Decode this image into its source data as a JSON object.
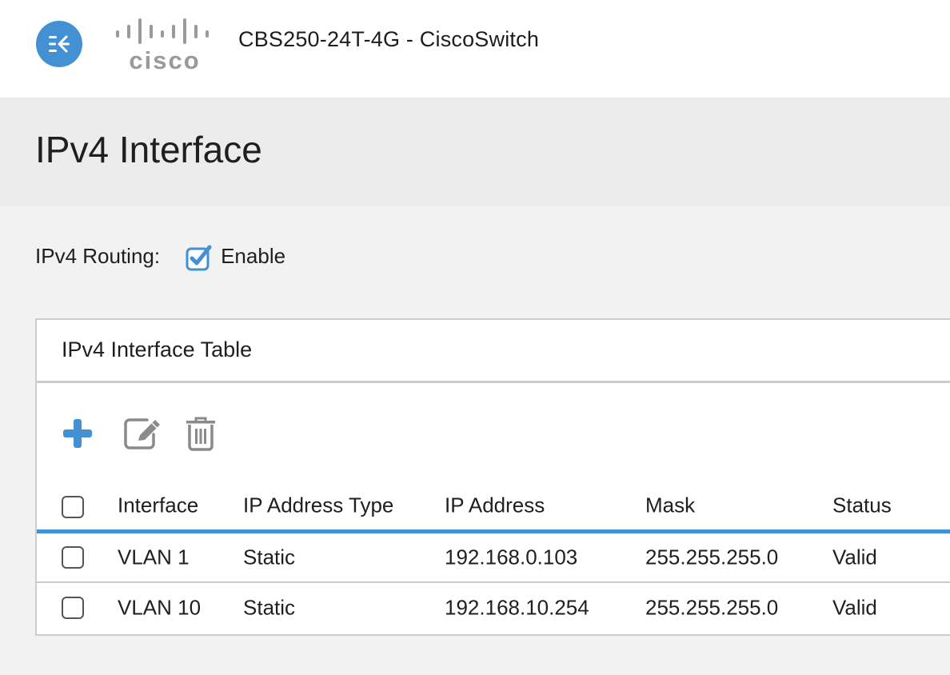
{
  "header": {
    "nav_toggle_icon": "collapse-menu-icon",
    "logo_text": "cisco",
    "app_title": "CBS250-24T-4G - CiscoSwitch"
  },
  "page": {
    "title": "IPv4 Interface"
  },
  "routing": {
    "label": "IPv4 Routing:",
    "checkbox_label": "Enable",
    "checked": true
  },
  "table_panel": {
    "title": "IPv4 Interface Table",
    "toolbar": {
      "add_icon": "plus-icon",
      "edit_icon": "edit-icon",
      "delete_icon": "trash-icon"
    },
    "columns": [
      "Interface",
      "IP Address Type",
      "IP Address",
      "Mask",
      "Status"
    ],
    "rows": [
      {
        "interface": "VLAN 1",
        "type": "Static",
        "ip": "192.168.0.103",
        "mask": "255.255.255.0",
        "status": "Valid",
        "selected": false
      },
      {
        "interface": "VLAN 10",
        "type": "Static",
        "ip": "192.168.10.254",
        "mask": "255.255.255.0",
        "status": "Valid",
        "selected": false
      }
    ]
  },
  "colors": {
    "accent": "#4391d3",
    "icon_gray": "#8a8a8a",
    "logo_gray": "#9a9a9a"
  }
}
